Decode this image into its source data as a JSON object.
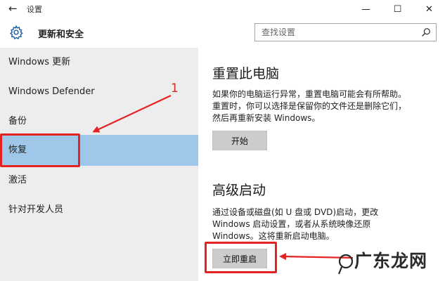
{
  "window": {
    "title": "设置",
    "back_icon": "←",
    "controls": [
      "—",
      "☐",
      "✕"
    ]
  },
  "header": {
    "section_title": "更新和安全",
    "search": {
      "placeholder": "查找设置"
    }
  },
  "sidebar": {
    "items": [
      {
        "label": "Windows 更新"
      },
      {
        "label": "Windows Defender"
      },
      {
        "label": "备份"
      },
      {
        "label": "恢复",
        "selected": true
      },
      {
        "label": "激活"
      },
      {
        "label": "针对开发人员"
      }
    ]
  },
  "main": {
    "reset": {
      "heading": "重置此电脑",
      "lines": [
        "如果你的电脑运行异常，重置电脑可能会有所帮助。",
        "重置时，你可以选择是保留你的文件还是删除它们，",
        "然后再重新安装 Windows。"
      ],
      "button": "开始"
    },
    "advanced": {
      "heading": "高级启动",
      "lines": [
        "通过设备或磁盘(如 U 盘或 DVD)启动，更改",
        "Windows 启动设置，或者从系统映像还原",
        "Windows。这将重新启动电脑。"
      ],
      "button": "立即重启"
    }
  },
  "annotation": {
    "number": "1"
  },
  "watermark": {
    "text": "广东龙网"
  },
  "colors": {
    "selected_nav": "#9ec7e9",
    "sidebar_bg": "#ededed",
    "annotation_red": "#e52222",
    "button_bg": "#cccccc"
  }
}
